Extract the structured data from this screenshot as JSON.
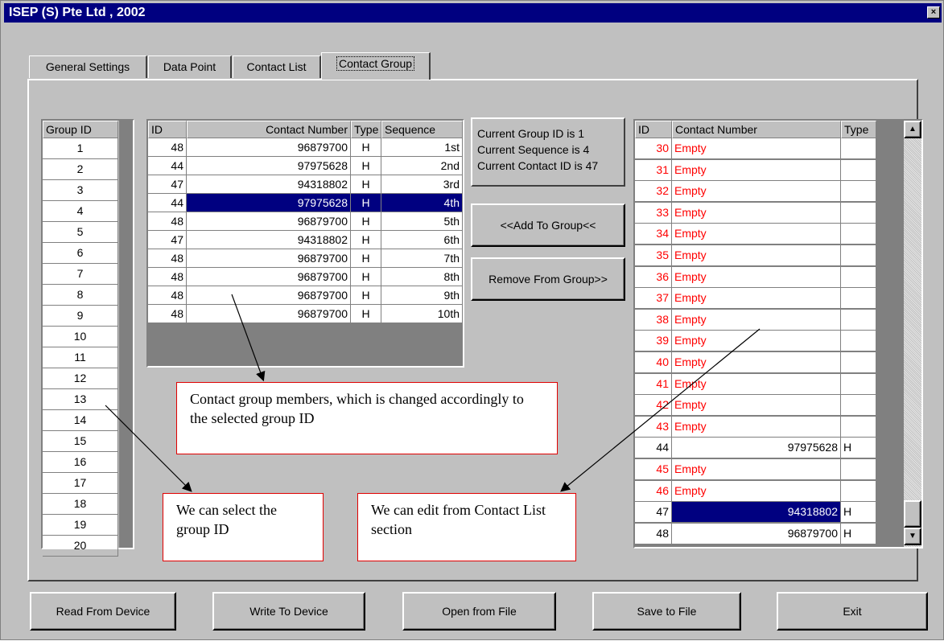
{
  "window": {
    "title": "ISEP (S) Pte Ltd , 2002",
    "close_glyph": "×"
  },
  "tabs": [
    {
      "label": "General Settings"
    },
    {
      "label": "Data Point"
    },
    {
      "label": "Contact List"
    },
    {
      "label": "Contact Group"
    }
  ],
  "group_list": {
    "header": "Group ID",
    "items": [
      "1",
      "2",
      "3",
      "4",
      "5",
      "6",
      "7",
      "8",
      "9",
      "10",
      "11",
      "12",
      "13",
      "14",
      "15",
      "16",
      "17",
      "18",
      "19",
      "20"
    ]
  },
  "members": {
    "headers": {
      "id": "ID",
      "contact_number": "Contact Number",
      "type": "Type",
      "sequence": "Sequence"
    },
    "rows": [
      {
        "id": "48",
        "number": "96879700",
        "type": "H",
        "seq": "1st"
      },
      {
        "id": "44",
        "number": "97975628",
        "type": "H",
        "seq": "2nd"
      },
      {
        "id": "47",
        "number": "94318802",
        "type": "H",
        "seq": "3rd"
      },
      {
        "id": "44",
        "number": "97975628",
        "type": "H",
        "seq": "4th"
      },
      {
        "id": "48",
        "number": "96879700",
        "type": "H",
        "seq": "5th"
      },
      {
        "id": "47",
        "number": "94318802",
        "type": "H",
        "seq": "6th"
      },
      {
        "id": "48",
        "number": "96879700",
        "type": "H",
        "seq": "7th"
      },
      {
        "id": "48",
        "number": "96879700",
        "type": "H",
        "seq": "8th"
      },
      {
        "id": "48",
        "number": "96879700",
        "type": "H",
        "seq": "9th"
      },
      {
        "id": "48",
        "number": "96879700",
        "type": "H",
        "seq": "10th"
      }
    ],
    "selected_index": 3
  },
  "info": {
    "line1": "Current Group ID is 1",
    "line2": "Current Sequence is 4",
    "line3": "Current Contact ID is 47"
  },
  "actions": {
    "add_label": "<<Add To Group<<",
    "remove_label": "Remove From Group>>"
  },
  "contacts": {
    "headers": {
      "id": "ID",
      "contact_number": "Contact Number",
      "type": "Type"
    },
    "rows": [
      {
        "id": "30",
        "number": "Empty",
        "type": "",
        "empty": true
      },
      {
        "id": "31",
        "number": "Empty",
        "type": "",
        "empty": true
      },
      {
        "id": "32",
        "number": "Empty",
        "type": "",
        "empty": true
      },
      {
        "id": "33",
        "number": "Empty",
        "type": "",
        "empty": true
      },
      {
        "id": "34",
        "number": "Empty",
        "type": "",
        "empty": true
      },
      {
        "id": "35",
        "number": "Empty",
        "type": "",
        "empty": true
      },
      {
        "id": "36",
        "number": "Empty",
        "type": "",
        "empty": true
      },
      {
        "id": "37",
        "number": "Empty",
        "type": "",
        "empty": true
      },
      {
        "id": "38",
        "number": "Empty",
        "type": "",
        "empty": true
      },
      {
        "id": "39",
        "number": "Empty",
        "type": "",
        "empty": true
      },
      {
        "id": "40",
        "number": "Empty",
        "type": "",
        "empty": true
      },
      {
        "id": "41",
        "number": "Empty",
        "type": "",
        "empty": true
      },
      {
        "id": "42",
        "number": "Empty",
        "type": "",
        "empty": true
      },
      {
        "id": "43",
        "number": "Empty",
        "type": "",
        "empty": true
      },
      {
        "id": "44",
        "number": "97975628",
        "type": "H",
        "empty": false
      },
      {
        "id": "45",
        "number": "Empty",
        "type": "",
        "empty": true
      },
      {
        "id": "46",
        "number": "Empty",
        "type": "",
        "empty": true
      },
      {
        "id": "47",
        "number": "94318802",
        "type": "H",
        "empty": false
      },
      {
        "id": "48",
        "number": "96879700",
        "type": "H",
        "empty": false
      }
    ],
    "selected_index": 17,
    "scroll_up_glyph": "▲",
    "scroll_down_glyph": "▼"
  },
  "annotations": {
    "members_note": "Contact group members, which is changed accordingly to the selected group ID",
    "group_note": "We can select the group ID",
    "edit_note": "We can edit from Contact List section"
  },
  "bottom_buttons": [
    {
      "label": "Read From Device"
    },
    {
      "label": "Write To Device"
    },
    {
      "label": "Open from File"
    },
    {
      "label": "Save to File"
    },
    {
      "label": "Exit"
    }
  ],
  "colors": {
    "title_bar": "#000080",
    "selection": "#000080",
    "empty_text": "#ff0000",
    "face": "#c0c0c0",
    "note_border": "#e00000"
  }
}
